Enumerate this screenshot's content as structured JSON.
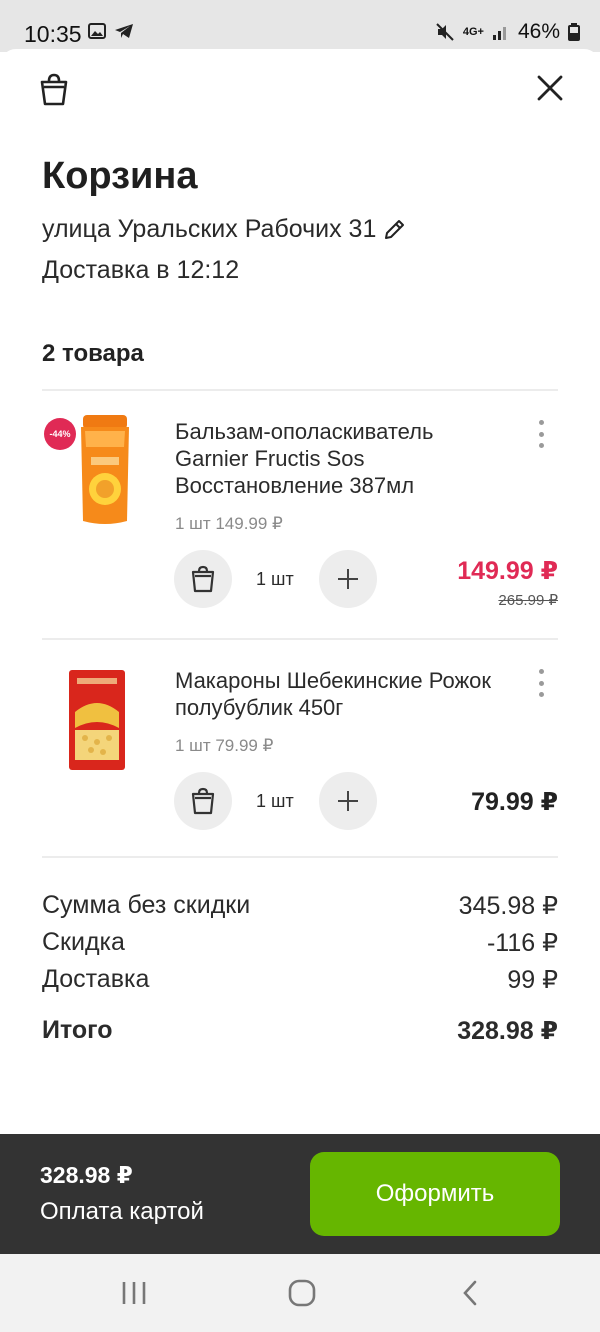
{
  "status_bar": {
    "time": "10:35",
    "battery": "46%",
    "network": "4G+"
  },
  "header": {
    "title": "Корзина",
    "address": "улица Уральских Рабочих 31",
    "delivery": "Доставка в 12:12",
    "items_count": "2 товара"
  },
  "items": [
    {
      "name": "Бальзам-ополаскиватель Garnier Fructis Sos Восстановление 387мл",
      "unit_price": "1 шт 149.99 ₽",
      "quantity": "1 шт",
      "price": "149.99 ₽",
      "old_price": "265.99 ₽",
      "discount": "-44%",
      "price_color": "#e02a55"
    },
    {
      "name": "Макароны Шебекинские Рожок полубублик 450г",
      "unit_price": "1 шт 79.99 ₽",
      "quantity": "1 шт",
      "price": "79.99 ₽"
    }
  ],
  "summary": {
    "without_discount_label": "Сумма без скидки",
    "without_discount_value": "345.98 ₽",
    "discount_label": "Скидка",
    "discount_value": "-116 ₽",
    "delivery_label": "Доставка",
    "delivery_value": "99 ₽",
    "total_label": "Итого",
    "total_value": "328.98 ₽"
  },
  "bottom": {
    "total": "328.98 ₽",
    "payment": "Оплата картой",
    "checkout_label": "Оформить",
    "accent_color": "#66b600"
  }
}
